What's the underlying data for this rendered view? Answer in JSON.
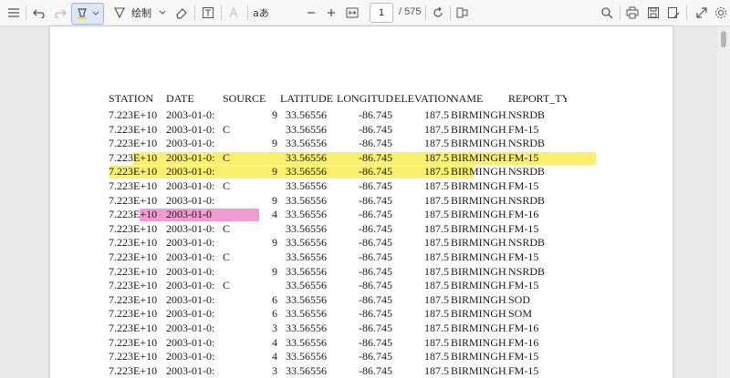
{
  "toolbar": {
    "draw_label": "绘制",
    "text_style_label": "aあ",
    "page_current": "1",
    "page_total": "/ 575",
    "highlight_color": "#f5e03c"
  },
  "headers": [
    "STATION",
    "DATE",
    "SOURCE",
    "LATITUDE",
    "LONGITUDE",
    "ELEVATION",
    "NAME",
    "REPORT_TYI"
  ],
  "rows": [
    [
      "7.223E+10",
      "2003-01-0:",
      "",
      "9",
      "33.56556",
      "-86.745",
      "187.5",
      "BIRMINGHAI",
      "NSRDB"
    ],
    [
      "7.223E+10",
      "2003-01-0:",
      "C",
      "",
      "33.56556",
      "-86.745",
      "187.5",
      "BIRMINGHAI",
      "FM-15"
    ],
    [
      "7.223E+10",
      "2003-01-0:",
      "",
      "9",
      "33.56556",
      "-86.745",
      "187.5",
      "BIRMINGHAI",
      "NSRDB"
    ],
    [
      "7.223E+10",
      "2003-01-0:",
      "C",
      "",
      "33.56556",
      "-86.745",
      "187.5",
      "BIRMINGHAI",
      "FM-15"
    ],
    [
      "7.223E+10",
      "2003-01-0:",
      "",
      "9",
      "33.56556",
      "-86.745",
      "187.5",
      "BIRMINGHAI",
      "NSRDB"
    ],
    [
      "7.223E+10",
      "2003-01-0:",
      "C",
      "",
      "33.56556",
      "-86.745",
      "187.5",
      "BIRMINGHAI",
      "FM-15"
    ],
    [
      "7.223E+10",
      "2003-01-0:",
      "",
      "9",
      "33.56556",
      "-86.745",
      "187.5",
      "BIRMINGHAI",
      "NSRDB"
    ],
    [
      "7.223E+10",
      "2003-01-0",
      "",
      "4",
      "33.56556",
      "-86.745",
      "187.5",
      "BIRMINGHAI",
      "FM-16"
    ],
    [
      "7.223E+10",
      "2003-01-0:",
      "C",
      "",
      "33.56556",
      "-86.745",
      "187.5",
      "BIRMINGHAI",
      "FM-15"
    ],
    [
      "7.223E+10",
      "2003-01-0:",
      "",
      "9",
      "33.56556",
      "-86.745",
      "187.5",
      "BIRMINGHAI",
      "NSRDB"
    ],
    [
      "7.223E+10",
      "2003-01-0:",
      "C",
      "",
      "33.56556",
      "-86.745",
      "187.5",
      "BIRMINGHAI",
      "FM-15"
    ],
    [
      "7.223E+10",
      "2003-01-0:",
      "",
      "9",
      "33.56556",
      "-86.745",
      "187.5",
      "BIRMINGHAI",
      "NSRDB"
    ],
    [
      "7.223E+10",
      "2003-01-0:",
      "C",
      "",
      "33.56556",
      "-86.745",
      "187.5",
      "BIRMINGHAI",
      "FM-15"
    ],
    [
      "7.223E+10",
      "2003-01-0:",
      "",
      "6",
      "33.56556",
      "-86.745",
      "187.5",
      "BIRMINGHAI",
      "SOD"
    ],
    [
      "7.223E+10",
      "2003-01-0:",
      "",
      "6",
      "33.56556",
      "-86.745",
      "187.5",
      "BIRMINGHAI",
      "SOM"
    ],
    [
      "7.223E+10",
      "2003-01-0:",
      "",
      "3",
      "33.56556",
      "-86.745",
      "187.5",
      "BIRMINGHAI",
      "FM-16"
    ],
    [
      "7.223E+10",
      "2003-01-0:",
      "",
      "4",
      "33.56556",
      "-86.745",
      "187.5",
      "BIRMINGHAI",
      "FM-16"
    ],
    [
      "7.223E+10",
      "2003-01-0:",
      "",
      "4",
      "33.56556",
      "-86.745",
      "187.5",
      "BIRMINGHAI",
      "FM-15"
    ],
    [
      "7.223E+10",
      "2003-01-0:",
      "",
      "3",
      "33.56556",
      "-86.745",
      "187.5",
      "BIRMINGHAI",
      "FM-15"
    ]
  ],
  "highlights": [
    {
      "row": 3,
      "color": "#fbef6e"
    },
    {
      "row": 4,
      "color": "#fbef6e"
    },
    {
      "row": 7,
      "color": "#f29ad2"
    }
  ]
}
